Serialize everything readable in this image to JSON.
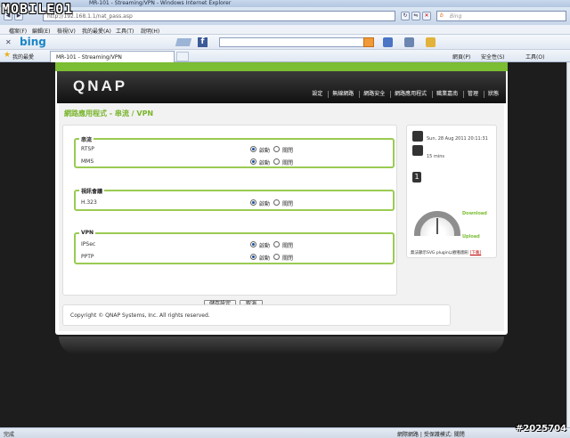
{
  "watermark": {
    "logo": "MOBILE01",
    "id": "#2025704"
  },
  "window": {
    "title": "MR-101 - Streaming/VPN - Windows Internet Explorer"
  },
  "address": {
    "url": "http://192.168.1.1/nat_pass.asp"
  },
  "search": {
    "placeholder": "Bing"
  },
  "menu": {
    "items": [
      "檔案(F)",
      "編輯(E)",
      "檢視(V)",
      "我的最愛(A)",
      "工具(T)",
      "說明(H)"
    ]
  },
  "bing_toolbar": {
    "logo": "bing"
  },
  "favorites": {
    "label": "我的最愛",
    "tab_title": "MR-101 - Streaming/VPN",
    "right_items": [
      "網頁(P)",
      "安全性(S)",
      "工具(O)"
    ]
  },
  "qnap": {
    "logo": "QNAP",
    "nav": [
      "設定",
      "無線網路",
      "網路安全",
      "網路應用程式",
      "職業嘉南",
      "管理",
      "狀態"
    ],
    "page_title": "網路應用程式 - 串流 / VPN",
    "sections": [
      {
        "title": "串流",
        "rows": [
          {
            "label": "RTSP",
            "on": "啟動",
            "off": "關閉",
            "selected": "on"
          },
          {
            "label": "MMS",
            "on": "啟動",
            "off": "關閉",
            "selected": "on"
          }
        ]
      },
      {
        "title": "視訊會議",
        "rows": [
          {
            "label": "H.323",
            "on": "啟動",
            "off": "關閉",
            "selected": "on"
          }
        ]
      },
      {
        "title": "VPN",
        "rows": [
          {
            "label": "IPSec",
            "on": "啟動",
            "off": "關閉",
            "selected": "on"
          },
          {
            "label": "PPTP",
            "on": "啟動",
            "off": "關閉",
            "selected": "on"
          }
        ]
      }
    ],
    "buttons": {
      "save": "儲存設定",
      "cancel": "取消"
    },
    "sidebar": {
      "datetime": "Sun, 28 Aug 2011 20:11:31",
      "uptime": "15 mins",
      "number": "1",
      "download": "Download",
      "upload": "Upload",
      "note": "無法顯示SVG plugin以觀看圖形",
      "note_link": "[下載]"
    },
    "footer": "Copyright © QNAP Systems, Inc. All rights reserved."
  },
  "status": {
    "left": "完成",
    "right": "網際網路 | 受保護模式: 關閉"
  }
}
